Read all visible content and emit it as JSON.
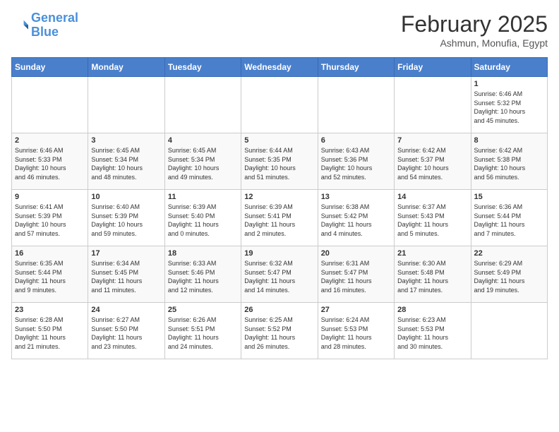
{
  "logo": {
    "line1": "General",
    "line2": "Blue"
  },
  "title": "February 2025",
  "location": "Ashmun, Monufia, Egypt",
  "days_of_week": [
    "Sunday",
    "Monday",
    "Tuesday",
    "Wednesday",
    "Thursday",
    "Friday",
    "Saturday"
  ],
  "weeks": [
    [
      {
        "day": "",
        "info": ""
      },
      {
        "day": "",
        "info": ""
      },
      {
        "day": "",
        "info": ""
      },
      {
        "day": "",
        "info": ""
      },
      {
        "day": "",
        "info": ""
      },
      {
        "day": "",
        "info": ""
      },
      {
        "day": "1",
        "info": "Sunrise: 6:46 AM\nSunset: 5:32 PM\nDaylight: 10 hours\nand 45 minutes."
      }
    ],
    [
      {
        "day": "2",
        "info": "Sunrise: 6:46 AM\nSunset: 5:33 PM\nDaylight: 10 hours\nand 46 minutes."
      },
      {
        "day": "3",
        "info": "Sunrise: 6:45 AM\nSunset: 5:34 PM\nDaylight: 10 hours\nand 48 minutes."
      },
      {
        "day": "4",
        "info": "Sunrise: 6:45 AM\nSunset: 5:34 PM\nDaylight: 10 hours\nand 49 minutes."
      },
      {
        "day": "5",
        "info": "Sunrise: 6:44 AM\nSunset: 5:35 PM\nDaylight: 10 hours\nand 51 minutes."
      },
      {
        "day": "6",
        "info": "Sunrise: 6:43 AM\nSunset: 5:36 PM\nDaylight: 10 hours\nand 52 minutes."
      },
      {
        "day": "7",
        "info": "Sunrise: 6:42 AM\nSunset: 5:37 PM\nDaylight: 10 hours\nand 54 minutes."
      },
      {
        "day": "8",
        "info": "Sunrise: 6:42 AM\nSunset: 5:38 PM\nDaylight: 10 hours\nand 56 minutes."
      }
    ],
    [
      {
        "day": "9",
        "info": "Sunrise: 6:41 AM\nSunset: 5:39 PM\nDaylight: 10 hours\nand 57 minutes."
      },
      {
        "day": "10",
        "info": "Sunrise: 6:40 AM\nSunset: 5:39 PM\nDaylight: 10 hours\nand 59 minutes."
      },
      {
        "day": "11",
        "info": "Sunrise: 6:39 AM\nSunset: 5:40 PM\nDaylight: 11 hours\nand 0 minutes."
      },
      {
        "day": "12",
        "info": "Sunrise: 6:39 AM\nSunset: 5:41 PM\nDaylight: 11 hours\nand 2 minutes."
      },
      {
        "day": "13",
        "info": "Sunrise: 6:38 AM\nSunset: 5:42 PM\nDaylight: 11 hours\nand 4 minutes."
      },
      {
        "day": "14",
        "info": "Sunrise: 6:37 AM\nSunset: 5:43 PM\nDaylight: 11 hours\nand 5 minutes."
      },
      {
        "day": "15",
        "info": "Sunrise: 6:36 AM\nSunset: 5:44 PM\nDaylight: 11 hours\nand 7 minutes."
      }
    ],
    [
      {
        "day": "16",
        "info": "Sunrise: 6:35 AM\nSunset: 5:44 PM\nDaylight: 11 hours\nand 9 minutes."
      },
      {
        "day": "17",
        "info": "Sunrise: 6:34 AM\nSunset: 5:45 PM\nDaylight: 11 hours\nand 11 minutes."
      },
      {
        "day": "18",
        "info": "Sunrise: 6:33 AM\nSunset: 5:46 PM\nDaylight: 11 hours\nand 12 minutes."
      },
      {
        "day": "19",
        "info": "Sunrise: 6:32 AM\nSunset: 5:47 PM\nDaylight: 11 hours\nand 14 minutes."
      },
      {
        "day": "20",
        "info": "Sunrise: 6:31 AM\nSunset: 5:47 PM\nDaylight: 11 hours\nand 16 minutes."
      },
      {
        "day": "21",
        "info": "Sunrise: 6:30 AM\nSunset: 5:48 PM\nDaylight: 11 hours\nand 17 minutes."
      },
      {
        "day": "22",
        "info": "Sunrise: 6:29 AM\nSunset: 5:49 PM\nDaylight: 11 hours\nand 19 minutes."
      }
    ],
    [
      {
        "day": "23",
        "info": "Sunrise: 6:28 AM\nSunset: 5:50 PM\nDaylight: 11 hours\nand 21 minutes."
      },
      {
        "day": "24",
        "info": "Sunrise: 6:27 AM\nSunset: 5:50 PM\nDaylight: 11 hours\nand 23 minutes."
      },
      {
        "day": "25",
        "info": "Sunrise: 6:26 AM\nSunset: 5:51 PM\nDaylight: 11 hours\nand 24 minutes."
      },
      {
        "day": "26",
        "info": "Sunrise: 6:25 AM\nSunset: 5:52 PM\nDaylight: 11 hours\nand 26 minutes."
      },
      {
        "day": "27",
        "info": "Sunrise: 6:24 AM\nSunset: 5:53 PM\nDaylight: 11 hours\nand 28 minutes."
      },
      {
        "day": "28",
        "info": "Sunrise: 6:23 AM\nSunset: 5:53 PM\nDaylight: 11 hours\nand 30 minutes."
      },
      {
        "day": "",
        "info": ""
      }
    ]
  ]
}
